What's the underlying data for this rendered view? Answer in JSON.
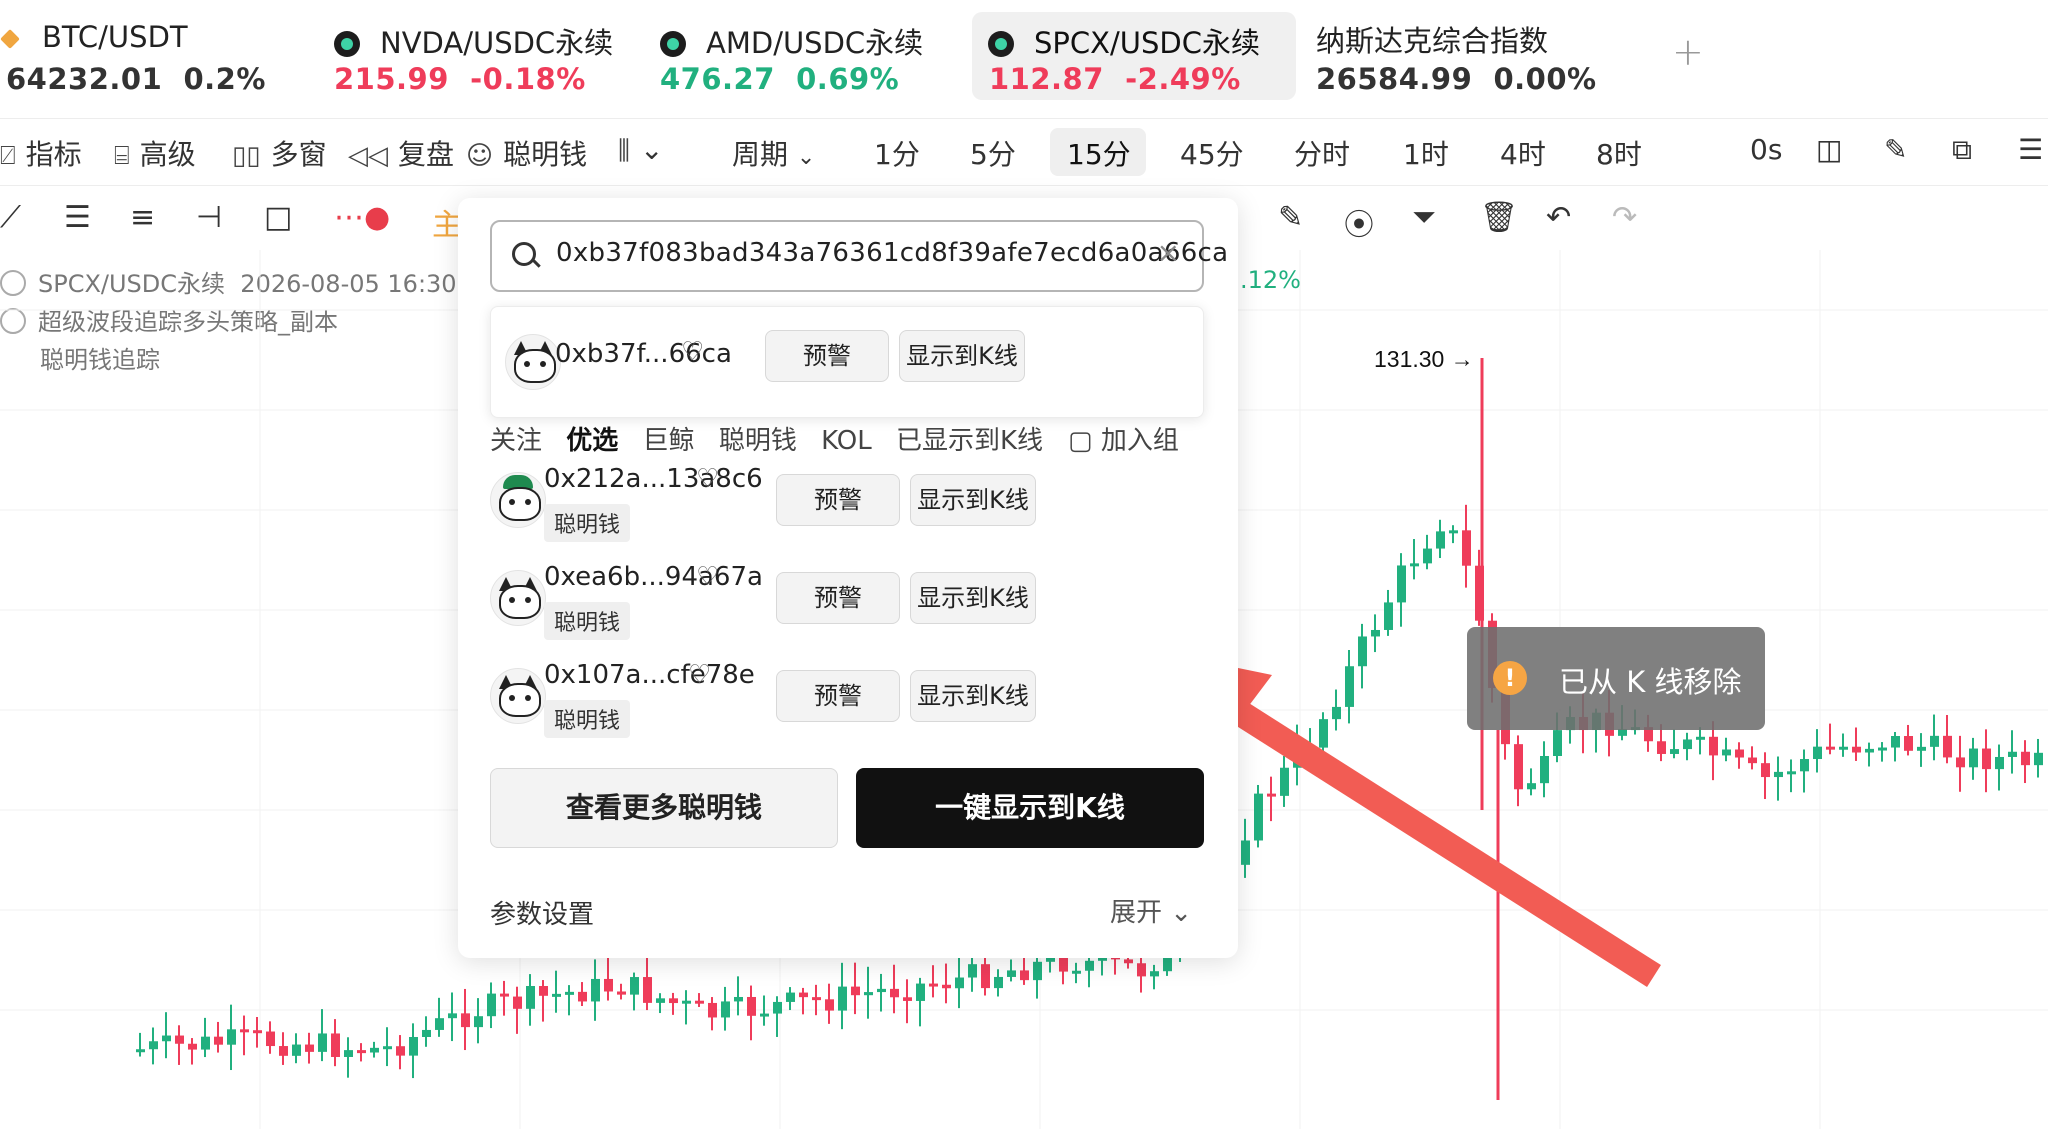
{
  "tickers": [
    {
      "name": "BTC/USDT",
      "price": "64232.01",
      "change": "0.2%",
      "tone": "dark",
      "icon": "btc-icon"
    },
    {
      "name": "NVDA/USDC永续",
      "price": "215.99",
      "change": "-0.18%",
      "tone": "red",
      "icon": "coin-icon"
    },
    {
      "name": "AMD/USDC永续",
      "price": "476.27",
      "change": "0.69%",
      "tone": "green",
      "icon": "coin-icon"
    },
    {
      "name": "SPCX/USDC永续",
      "price": "112.87",
      "change": "-2.49%",
      "tone": "red",
      "icon": "coin-icon",
      "active": true
    },
    {
      "name": "纳斯达克综合指数",
      "price": "26584.99",
      "change": "0.00%",
      "tone": "dark"
    }
  ],
  "toolbar": {
    "indicators": "指标",
    "advanced": "高级",
    "multi_window": "多窗",
    "replay": "复盘",
    "smart_money": "聪明钱",
    "period": "周期",
    "intervals": [
      "1分",
      "5分",
      "15分",
      "45分",
      "分时",
      "1时",
      "4时",
      "8时"
    ],
    "selected_interval": "15分",
    "countdown": "0s"
  },
  "legend": {
    "symbol": "SPCX/USDC永续",
    "datetime": "2026-08-05 16:30",
    "strategy": "超级波段追踪多头策略_副本",
    "tracking": "聪明钱追踪",
    "pct_fragment": ".12%"
  },
  "chart_data": {
    "type": "candlestick",
    "annotations": [
      {
        "label": "131.30 →",
        "note": "high marker"
      }
    ],
    "colors": {
      "up": "#21b07f",
      "down": "#ef3c5a"
    }
  },
  "popup": {
    "search_value": "0xb37f083bad343a76361cd8f39afe7ecd6a0a66ca",
    "result": {
      "address": "0xb37f...66ca",
      "alert": "预警",
      "show": "显示到K线"
    },
    "tabs": {
      "follow": "关注",
      "selected": "优选",
      "whale": "巨鲸",
      "smart": "聪明钱",
      "kol": "KOL",
      "shown": "已显示到K线",
      "add": "加入组"
    },
    "rows": [
      {
        "address": "0x212a...13a8c6",
        "badge": "聪明钱",
        "alert": "预警",
        "show": "显示到K线"
      },
      {
        "address": "0xea6b...94a67a",
        "badge": "聪明钱",
        "alert": "预警",
        "show": "显示到K线"
      },
      {
        "address": "0x107a...cfe78e",
        "badge": "聪明钱",
        "alert": "预警",
        "show": "显示到K线"
      }
    ],
    "more_button": "查看更多聪明钱",
    "show_all_button": "一键显示到K线",
    "params_label": "参数设置",
    "params_toggle": "展开"
  },
  "toast": {
    "text": "已从 K 线移除"
  },
  "colors": {
    "red": "#ef3c5a",
    "green": "#21b07f",
    "arrow": "#f25c54",
    "toast_bg": "#6e6e6e"
  }
}
